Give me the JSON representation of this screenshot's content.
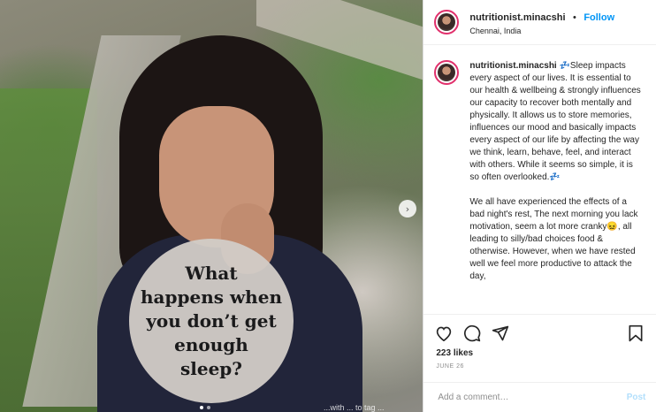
{
  "media": {
    "overlay_text": "What happens when you don’t get enough sleep?",
    "next_glyph": "›",
    "caption_tag": "...with ... to tag ..."
  },
  "header": {
    "username": "nutritionist.minacshi",
    "separator": "•",
    "follow_label": "Follow",
    "location": "Chennai, India"
  },
  "caption": {
    "username": "nutritionist.minacshi",
    "paragraph_1": "💤Sleep impacts every aspect of our lives. It is essential to our health & wellbeing & strongly influences our capacity to recover both mentally and physically. It allows us to store memories, influences our mood and basically impacts every aspect of our life by affecting the way we think, learn, behave, feel, and interact with others. While it seems so simple, it is so often overlooked.💤",
    "paragraph_2": "We all have experienced the effects of a bad night's rest, The next morning you lack motivation, seem a lot more cranky😖, all leading to silly/bad choices food & otherwise. However, when we have rested well we feel more productive to attack the day,"
  },
  "actions": {
    "icons": [
      "heart-icon",
      "comment-icon",
      "share-icon",
      "bookmark-icon"
    ],
    "likes": "223 likes",
    "date": "JUNE 26"
  },
  "comment": {
    "placeholder": "Add a comment…",
    "post_label": "Post"
  },
  "colors": {
    "accent": "#0095f6",
    "post_disabled": "#b2dffc",
    "text": "#262626",
    "muted": "#8e8e8e"
  }
}
